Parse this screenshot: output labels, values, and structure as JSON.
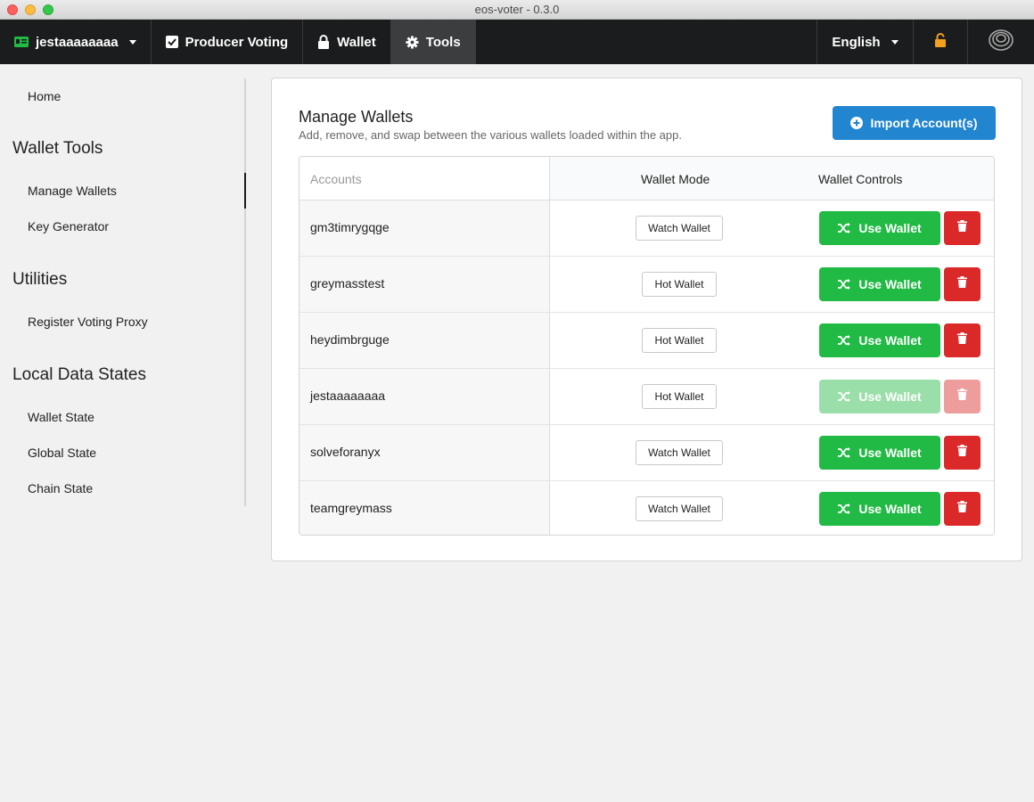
{
  "window": {
    "title": "eos-voter - 0.3.0"
  },
  "nav": {
    "account": "jestaaaaaaaa",
    "producer_voting": "Producer Voting",
    "wallet": "Wallet",
    "tools": "Tools",
    "language": "English"
  },
  "sidebar": {
    "home": "Home",
    "wallet_tools": "Wallet Tools",
    "manage_wallets": "Manage Wallets",
    "key_generator": "Key Generator",
    "utilities": "Utilities",
    "register_voting_proxy": "Register Voting Proxy",
    "local_data_states": "Local Data States",
    "wallet_state": "Wallet State",
    "global_state": "Global State",
    "chain_state": "Chain State"
  },
  "main": {
    "title": "Manage Wallets",
    "subtitle": "Add, remove, and swap between the various wallets loaded within the app.",
    "import_label": "Import Account(s)",
    "columns": {
      "accounts": "Accounts",
      "mode": "Wallet Mode",
      "controls": "Wallet Controls"
    },
    "use_label": "Use Wallet",
    "rows": [
      {
        "account": "gm3timrygqge",
        "mode": "Watch Wallet"
      },
      {
        "account": "greymasstest",
        "mode": "Hot Wallet"
      },
      {
        "account": "heydimbrguge",
        "mode": "Hot Wallet"
      },
      {
        "account": "jestaaaaaaaa",
        "mode": "Hot Wallet"
      },
      {
        "account": "solveforanyx",
        "mode": "Watch Wallet"
      },
      {
        "account": "teamgreymass",
        "mode": "Watch Wallet"
      }
    ]
  },
  "colors": {
    "primary": "#2185d0",
    "green": "#21ba45",
    "red": "#db2828",
    "nav": "#1b1c1d",
    "lock": "#f2a01e"
  },
  "icons": [
    "id-card-icon",
    "checkbox-icon",
    "lock-icon",
    "gear-icon",
    "unlock-icon",
    "greymass-logo-icon",
    "plus-circle-icon",
    "shuffle-icon",
    "trash-icon"
  ]
}
